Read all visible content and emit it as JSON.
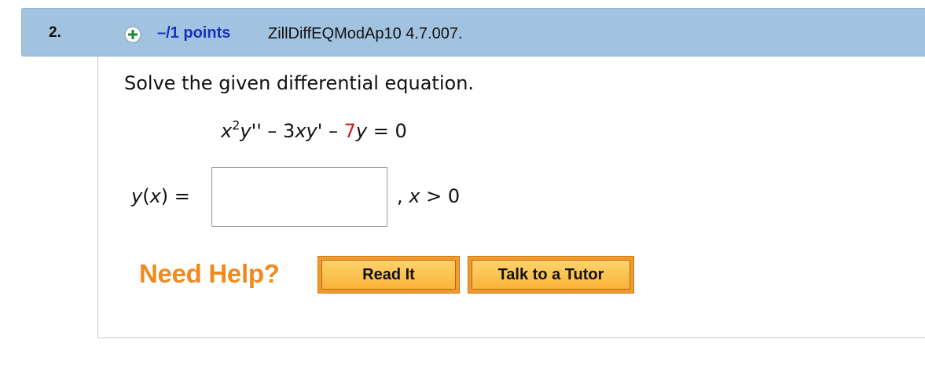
{
  "question": {
    "number": "2.",
    "points": "–/1 points",
    "code": "ZillDiffEQModAp10 4.7.007."
  },
  "prompt": "Solve the given differential equation.",
  "equation": {
    "x": "x",
    "exp": "2",
    "y1": "y''",
    "op1": " – 3",
    "xy": "xy'",
    "op2": " – ",
    "coef": "7",
    "y2": "y",
    "rhs": " = 0"
  },
  "answer": {
    "lhs_fn": "y",
    "lhs_arg": "x",
    "equals": "=",
    "value": "",
    "condition_sep": ", ",
    "condition_var": "x",
    "condition_rest": " > 0"
  },
  "help": {
    "label": "Need Help?",
    "read_it": "Read It",
    "tutor": "Talk to a Tutor"
  },
  "colors": {
    "header_bg": "#a1c3e0",
    "points_link": "#1a2fbf",
    "need_help": "#f08a1c",
    "coefficient_red": "#c81e1e",
    "plus_icon": "#1e8a2e"
  }
}
